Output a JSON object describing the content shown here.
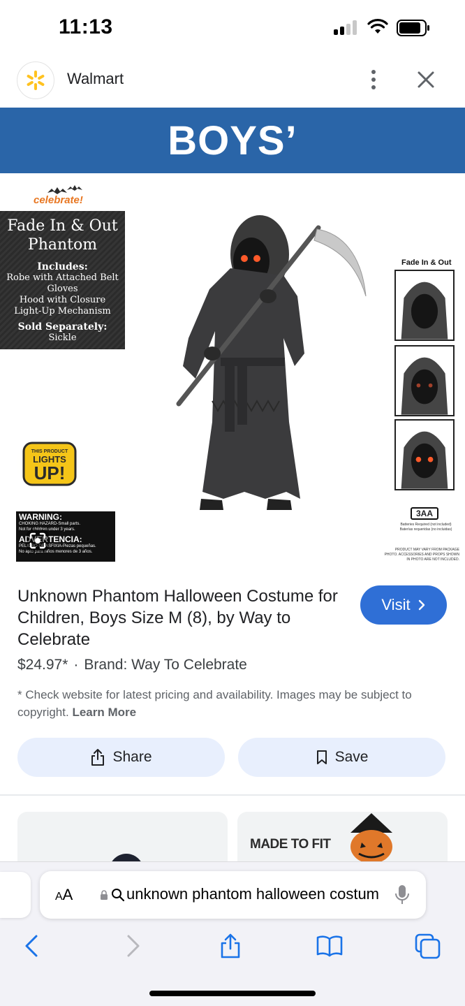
{
  "status_bar": {
    "time": "11:13"
  },
  "tab": {
    "site_name": "Walmart"
  },
  "product_image": {
    "banner": "BOYS’",
    "brand_logo_text": "celebrate!",
    "info_box": {
      "title": "Fade In & Out Phantom",
      "includes_label": "Includes:",
      "includes": [
        "Robe with Attached Belt",
        "Gloves",
        "Hood with Closure",
        "Light-Up Mechanism"
      ],
      "sold_separately_label": "Sold Separately:",
      "sold_separately": "Sickle"
    },
    "badge": {
      "line1": "THIS PRODUCT",
      "line2": "LIGHTS",
      "line3": "UP!"
    },
    "warning": {
      "title": "WARNING:",
      "line1": "CHOKING HAZARD-Small parts.",
      "line2": "Not for children under 3 years.",
      "title_es": "ADVERTENCIA:",
      "line1_es": "PELIGRO DE ASFIXIA-Piezas pequeñas.",
      "line2_es": "No apto para niños menores de 3 años."
    },
    "side_label": "Fade In & Out",
    "battery_label": "3AA",
    "battery_note": "Batteries Required (not included)",
    "battery_note_es": "Baterías requeridas (no incluidas)",
    "disclaimer": "PRODUCT MAY VARY FROM PACKAGE PHOTO. ACCESSORIES AND PROPS SHOWN IN PHOTO ARE NOT INCLUDED."
  },
  "product": {
    "title": "Unknown Phantom Halloween Costume for Children, Boys Size M (8), by Way to Celebrate",
    "price": "$24.97*",
    "brand": "Brand: Way To Celebrate",
    "visit_label": "Visit",
    "disclaimer": "* Check website for latest pricing and availability. Images may be subject to copyright.",
    "learn_more": "Learn More",
    "share_label": "Share",
    "save_label": "Save"
  },
  "related": {
    "card2_text": "MADE TO FIT"
  },
  "browser": {
    "aa_label_big": "A",
    "aa_label_small": "A",
    "url": "unknown phantom halloween costume"
  },
  "colors": {
    "banner_blue": "#2a65a8",
    "visit_blue": "#2f6fd6",
    "pill_bg": "#e8effd",
    "walmart_yellow": "#ffc220",
    "ios_blue": "#1a73e8"
  }
}
